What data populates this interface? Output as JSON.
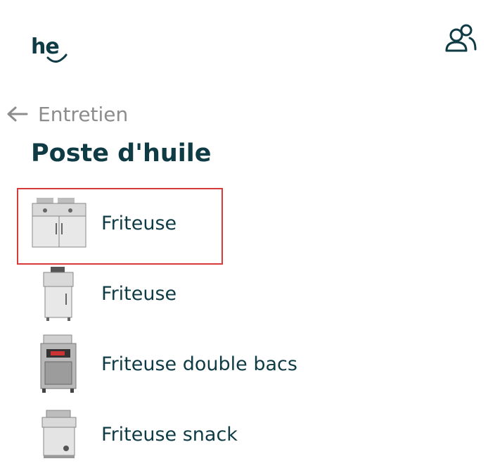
{
  "header": {
    "logo_text": "he",
    "users_icon": "users-icon"
  },
  "nav": {
    "back_label": "Entretien",
    "back_icon": "arrow-left-icon"
  },
  "page": {
    "title": "Poste d'huile"
  },
  "items": [
    {
      "label": "Friteuse",
      "icon": "double-fryer-cabinet-image",
      "selected": true
    },
    {
      "label": "Friteuse",
      "icon": "single-fryer-image",
      "selected": false
    },
    {
      "label": "Friteuse double bacs",
      "icon": "pressure-fryer-image",
      "selected": false
    },
    {
      "label": "Friteuse snack",
      "icon": "countertop-fryer-image",
      "selected": false
    }
  ],
  "colors": {
    "primary": "#0f3b45",
    "muted": "#8c8c8c",
    "selection_border": "#d83a3a"
  }
}
